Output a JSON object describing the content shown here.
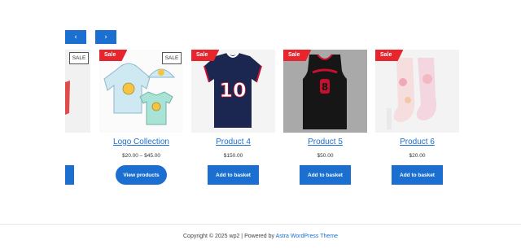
{
  "carousel": {
    "prev_icon": "chevron-left-icon",
    "next_icon": "chevron-right-icon",
    "prev_glyph": "‹",
    "next_glyph": "›"
  },
  "products": [
    {
      "badge": "SALE",
      "title": "",
      "price": "",
      "button": ""
    },
    {
      "badge": "Sale",
      "badge2": "SALE",
      "title": "Logo Collection",
      "price": "$20.00 – $45.00",
      "button": "View products"
    },
    {
      "badge": "Sale",
      "title": "Product 4",
      "price": "$150.00",
      "button": "Add to basket"
    },
    {
      "badge": "Sale",
      "title": "Product 5",
      "price": "$50.00",
      "button": "Add to basket"
    },
    {
      "badge": "Sale",
      "title": "Product 6",
      "price": "$20.00",
      "button": "Add to basket"
    }
  ],
  "footer": {
    "copyright": "Copyright © 2025 wp2 | Powered by ",
    "link": "Astra WordPress Theme"
  },
  "colors": {
    "accent": "#1a6fd1",
    "sale": "#e8252c"
  }
}
